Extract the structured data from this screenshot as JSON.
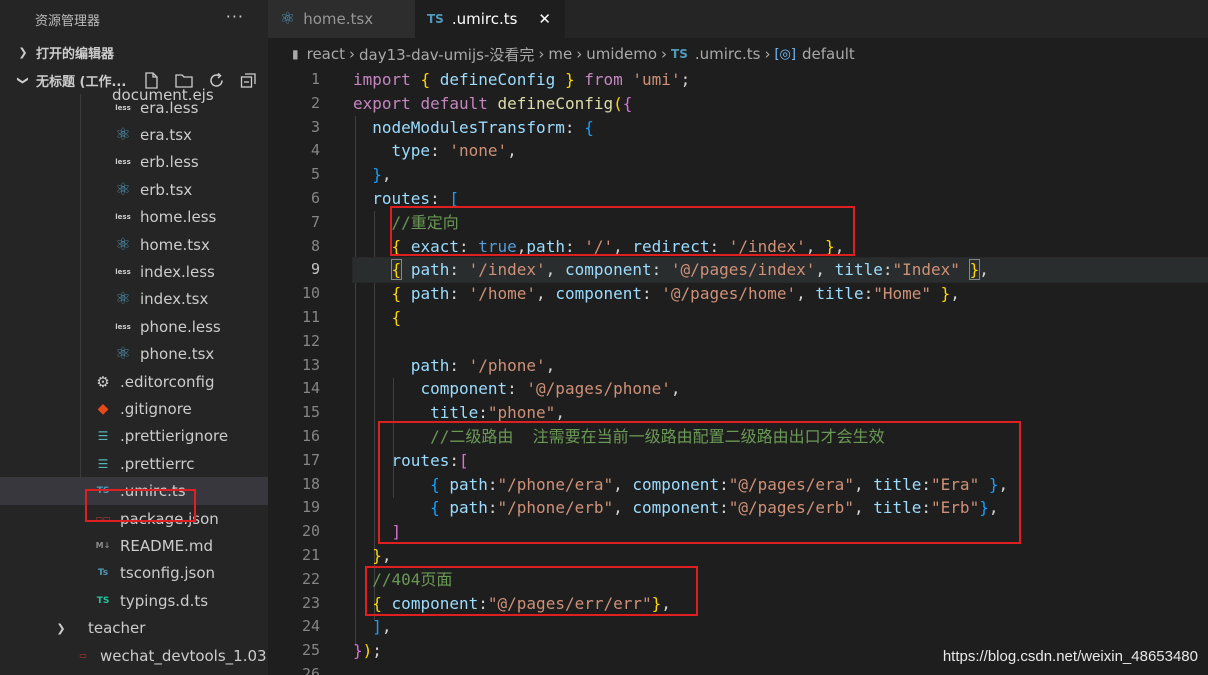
{
  "sidebar": {
    "title": "资源管理器",
    "more": "···",
    "open_editors": "打开的编辑器",
    "workspace": "无标题 (工作...",
    "cut_item": "document.ejs",
    "items": [
      {
        "label": "era.less",
        "icon": "less"
      },
      {
        "label": "era.tsx",
        "icon": "react"
      },
      {
        "label": "erb.less",
        "icon": "less"
      },
      {
        "label": "erb.tsx",
        "icon": "react"
      },
      {
        "label": "home.less",
        "icon": "less"
      },
      {
        "label": "home.tsx",
        "icon": "react"
      },
      {
        "label": "index.less",
        "icon": "less"
      },
      {
        "label": "index.tsx",
        "icon": "react"
      },
      {
        "label": "phone.less",
        "icon": "less"
      },
      {
        "label": "phone.tsx",
        "icon": "react"
      },
      {
        "label": ".editorconfig",
        "icon": "gear"
      },
      {
        "label": ".gitignore",
        "icon": "git"
      },
      {
        "label": ".prettierignore",
        "icon": "prettier"
      },
      {
        "label": ".prettierrc",
        "icon": "prettier"
      },
      {
        "label": ".umirc.ts",
        "icon": "ts"
      },
      {
        "label": "package.json",
        "icon": "json"
      },
      {
        "label": "README.md",
        "icon": "md"
      },
      {
        "label": "tsconfig.json",
        "icon": "tsconfig"
      },
      {
        "label": "typings.d.ts",
        "icon": "tsgreen"
      },
      {
        "label": "teacher",
        "icon": "folder"
      },
      {
        "label": "wechat_devtools_1.03",
        "icon": "json"
      }
    ]
  },
  "tabs": [
    {
      "label": "home.tsx",
      "icon": "react"
    },
    {
      "label": ".umirc.ts",
      "icon": "TS",
      "close": "✕"
    }
  ],
  "breadcrumb": [
    "react",
    "day13-dav-umijs-没看完",
    "me",
    "umidemo",
    ".umirc.ts",
    "default"
  ],
  "icon_labels": {
    "less": "less",
    "ts": "TS"
  },
  "watermark": "https://blog.csdn.net/weixin_48653480",
  "colors": {
    "highlight_box": "#e02020",
    "selected_bg": "#37373d"
  }
}
